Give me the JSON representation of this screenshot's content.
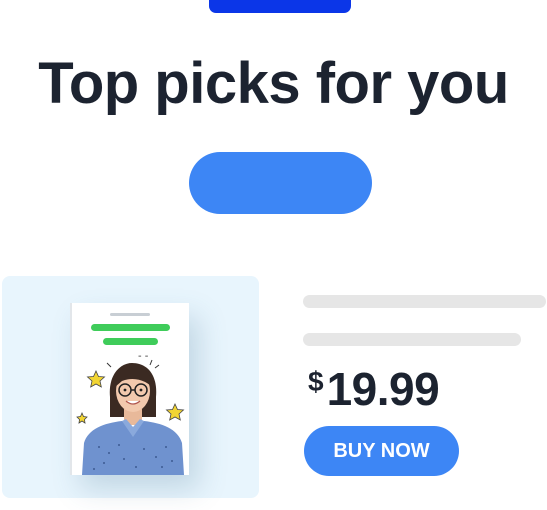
{
  "header": {
    "title": "Top picks for you"
  },
  "product": {
    "currency": "$",
    "price": "19.99",
    "buy_label": "BUY NOW",
    "cover_dashes": "- -"
  },
  "colors": {
    "accent": "#3d86f5",
    "top_bar": "#0b36e8",
    "title": "#1c2330",
    "card_bg": "#e8f5fd",
    "cover_green": "#3fcc5a",
    "skeleton": "#e6e6e6"
  }
}
